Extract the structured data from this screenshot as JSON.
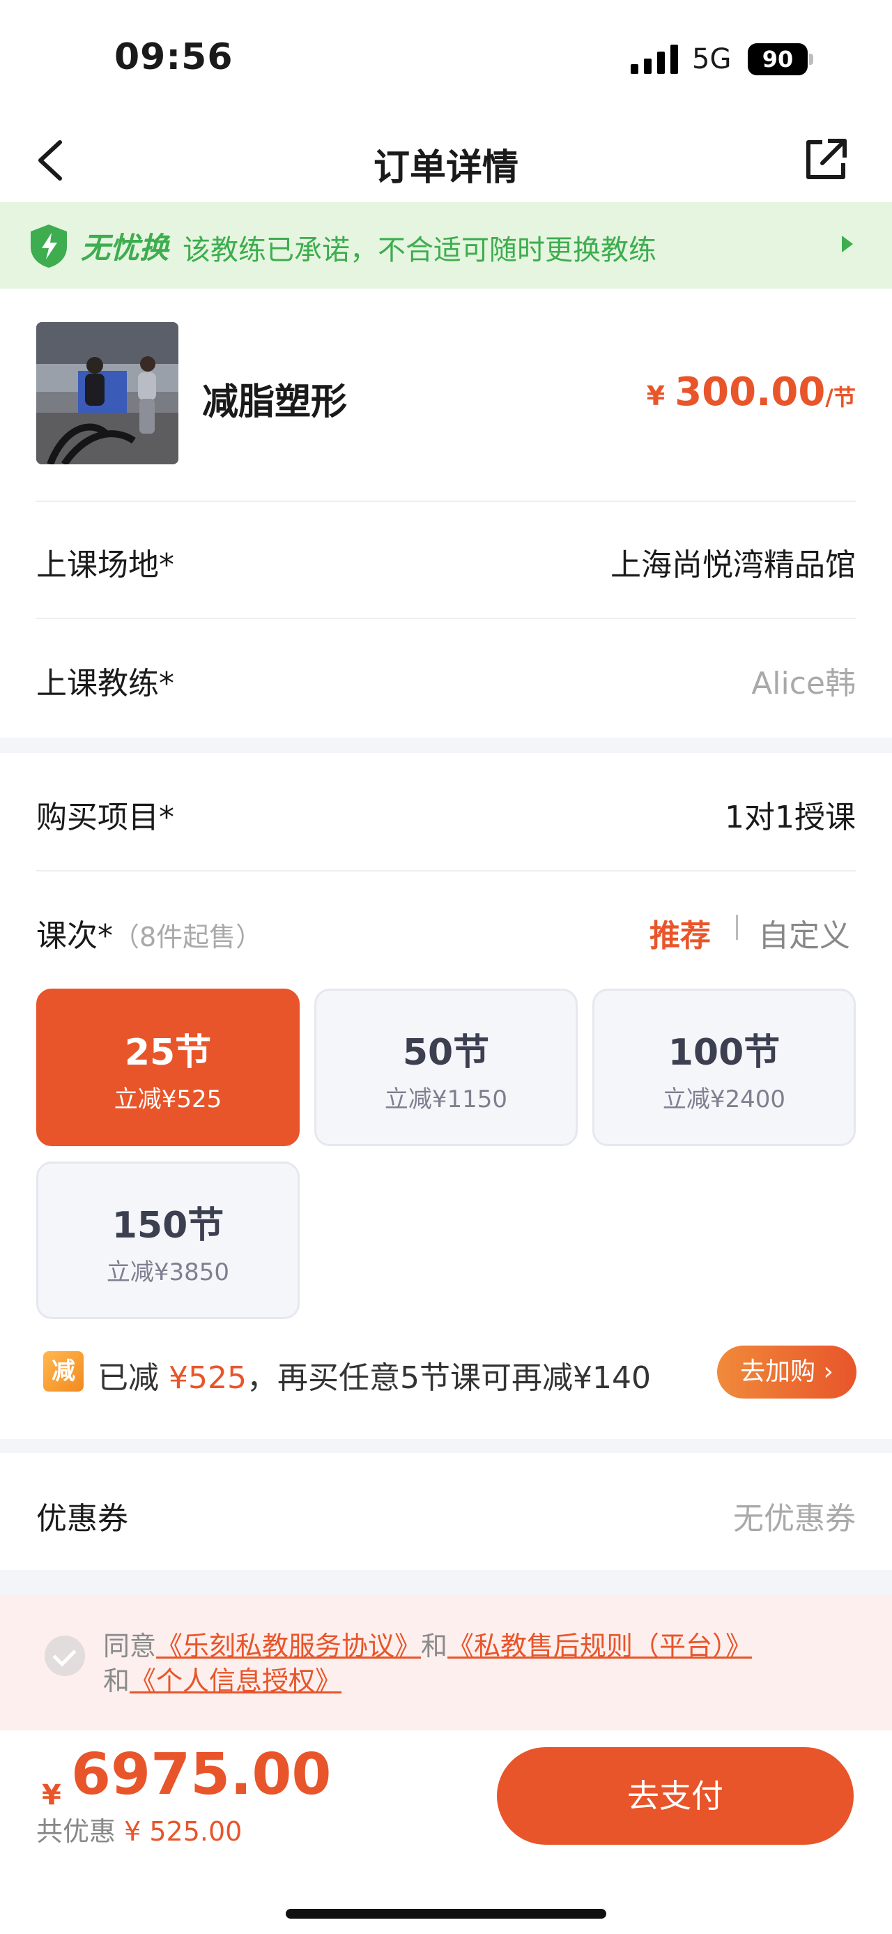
{
  "status_bar": {
    "time": "09:56",
    "network": "5G",
    "battery": "90"
  },
  "nav": {
    "title": "订单详情"
  },
  "promise": {
    "brand": "无忧换",
    "text": "该教练已承诺，不合适可随时更换教练"
  },
  "product": {
    "name": "减脂塑形",
    "currency": "¥",
    "price": "300.00",
    "unit": "/节"
  },
  "venue": {
    "label": "上课场地*",
    "value": "上海尚悦湾精品馆"
  },
  "coach": {
    "label": "上课教练*",
    "value": "Alice韩"
  },
  "item": {
    "label": "购买项目*",
    "value": "1对1授课"
  },
  "sessions": {
    "label": "课次*",
    "hint": "（8件起售）",
    "tab_recommend": "推荐",
    "tab_custom": "自定义",
    "options": [
      {
        "sessions": "25节",
        "discount": "立减¥525",
        "selected": true
      },
      {
        "sessions": "50节",
        "discount": "立减¥1150",
        "selected": false
      },
      {
        "sessions": "100节",
        "discount": "立减¥2400",
        "selected": false
      },
      {
        "sessions": "150节",
        "discount": "立减¥3850",
        "selected": false
      }
    ]
  },
  "discount": {
    "icon_text": "减",
    "prefix": "已减",
    "amount": "¥525",
    "suffix": "，再买任意5节课可再减¥140",
    "button": "去加购"
  },
  "coupon": {
    "label": "优惠券",
    "value": "无优惠券"
  },
  "agreement": {
    "agree_text": "同意",
    "link1": "《乐刻私教服务协议》",
    "and1": "和",
    "link2": "《私教售后规则（平台）》",
    "and2": "和",
    "link3": "《个人信息授权》"
  },
  "footer": {
    "currency": "¥",
    "total": "6975.00",
    "savings_label": "共优惠",
    "savings_amount": "¥ 525.00",
    "pay_button": "去支付"
  },
  "colors": {
    "accent": "#e8552a",
    "promise_green": "#3dad4f",
    "promise_bg": "#e6f5df"
  }
}
